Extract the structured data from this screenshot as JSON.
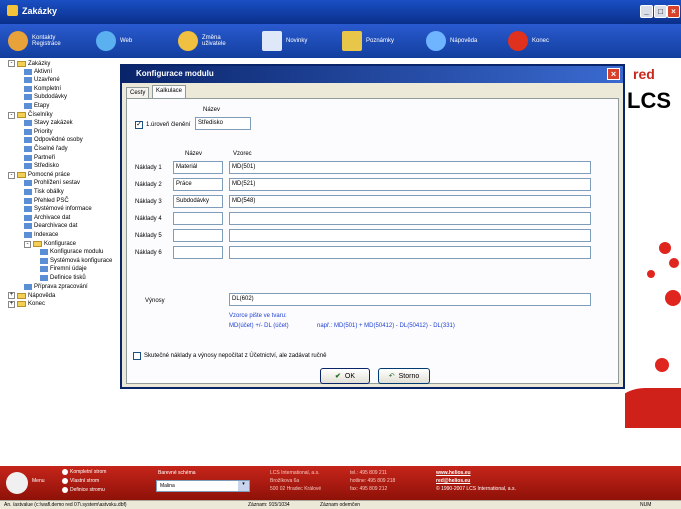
{
  "window": {
    "title": "Zakázky"
  },
  "toolbar": {
    "items": [
      {
        "label": "Kontakty Registrace",
        "icon": "contacts-icon"
      },
      {
        "label": "Web",
        "icon": "globe-icon"
      },
      {
        "label": "Změna uživatele",
        "icon": "users-icon"
      },
      {
        "label": "Novinky",
        "icon": "news-icon"
      },
      {
        "label": "Poznámky",
        "icon": "notes-icon"
      },
      {
        "label": "Nápověda",
        "icon": "help-icon"
      },
      {
        "label": "Konec",
        "icon": "exit-icon"
      }
    ]
  },
  "tree": {
    "items": [
      "Zakázky",
      "Aktivní",
      "Uzavřené",
      "Kompletní",
      "Subdodávky",
      "Etapy",
      "Číselníky",
      "Stavy zakázek",
      "Priority",
      "Odpovědné osoby",
      "Číselné řady",
      "Partneři",
      "Středisko",
      "Pomocné práce",
      "Prohlížení sestav",
      "Tisk obálky",
      "Přehled PSČ",
      "Systémové informace",
      "Archivace dat",
      "Dearchivace dat",
      "Indexace",
      "Konfigurace",
      "Konfigurace modulu",
      "Systémová konfigurace",
      "Firemní údaje",
      "Definice tisků",
      "Příprava zpracování",
      "Nápověda",
      "Konec"
    ]
  },
  "dialog": {
    "title": "Konfigurace modulu",
    "tabs": [
      "Cesty",
      "Kalkulace"
    ],
    "level": {
      "checkbox_label": "1.úroveň členění",
      "checked": true,
      "name_header": "Název",
      "value": "Středisko"
    },
    "headers": {
      "name": "Název",
      "formula": "Vzorec"
    },
    "rows": [
      {
        "label": "Náklady 1",
        "name": "Materiál",
        "formula": "MD(501)"
      },
      {
        "label": "Náklady 2",
        "name": "Práce",
        "formula": "MD(521)"
      },
      {
        "label": "Náklady 3",
        "name": "Subdodávky",
        "formula": "MD(548)"
      },
      {
        "label": "Náklady 4",
        "name": "",
        "formula": ""
      },
      {
        "label": "Náklady 5",
        "name": "",
        "formula": ""
      },
      {
        "label": "Náklady 6",
        "name": "",
        "formula": ""
      }
    ],
    "revenue": {
      "label": "Výnosy",
      "formula": "DL(602)"
    },
    "hint": {
      "title": "Vzorce pište ve tvaru:",
      "syntax": "MD(účet) +/- DL (účet)",
      "example": "např.: MD(501) + MD(50412) - DL(50412) - DL(331)"
    },
    "manual_checkbox": {
      "label": "Skutečné náklady a výnosy nepočítat z Účetnictví, ale zadávat ručně",
      "checked": false
    },
    "ok": "OK",
    "storno": "Storno"
  },
  "brand": {
    "text1": "red",
    "text2": "LCS",
    "text3": "red"
  },
  "bottom": {
    "menu": "Menu",
    "radios": [
      "Kompletní strom",
      "Vlastní strom",
      "Definice stromu"
    ],
    "scheme_label": "Barevné schéma",
    "scheme_value": "Malina",
    "company": [
      "LCS International, a.s.",
      "Brožíkova 6a",
      "500 02 Hradec Králové"
    ],
    "contacts": [
      "tel.:  495 809 211",
      "hotline: 495 809 218",
      "fax:  495 809 212"
    ],
    "web": [
      "www.helios.eu",
      "red@helios.eu",
      "© 1990-2007 LCS International, a.s."
    ]
  },
  "status": {
    "path": "An. /astvalue (c:\\wafl.demo red 07\\.system\\astvsku.dbf)",
    "record": "Záznam: 915/1034",
    "hidden": "Záznam odemčen",
    "num": "NUM"
  }
}
